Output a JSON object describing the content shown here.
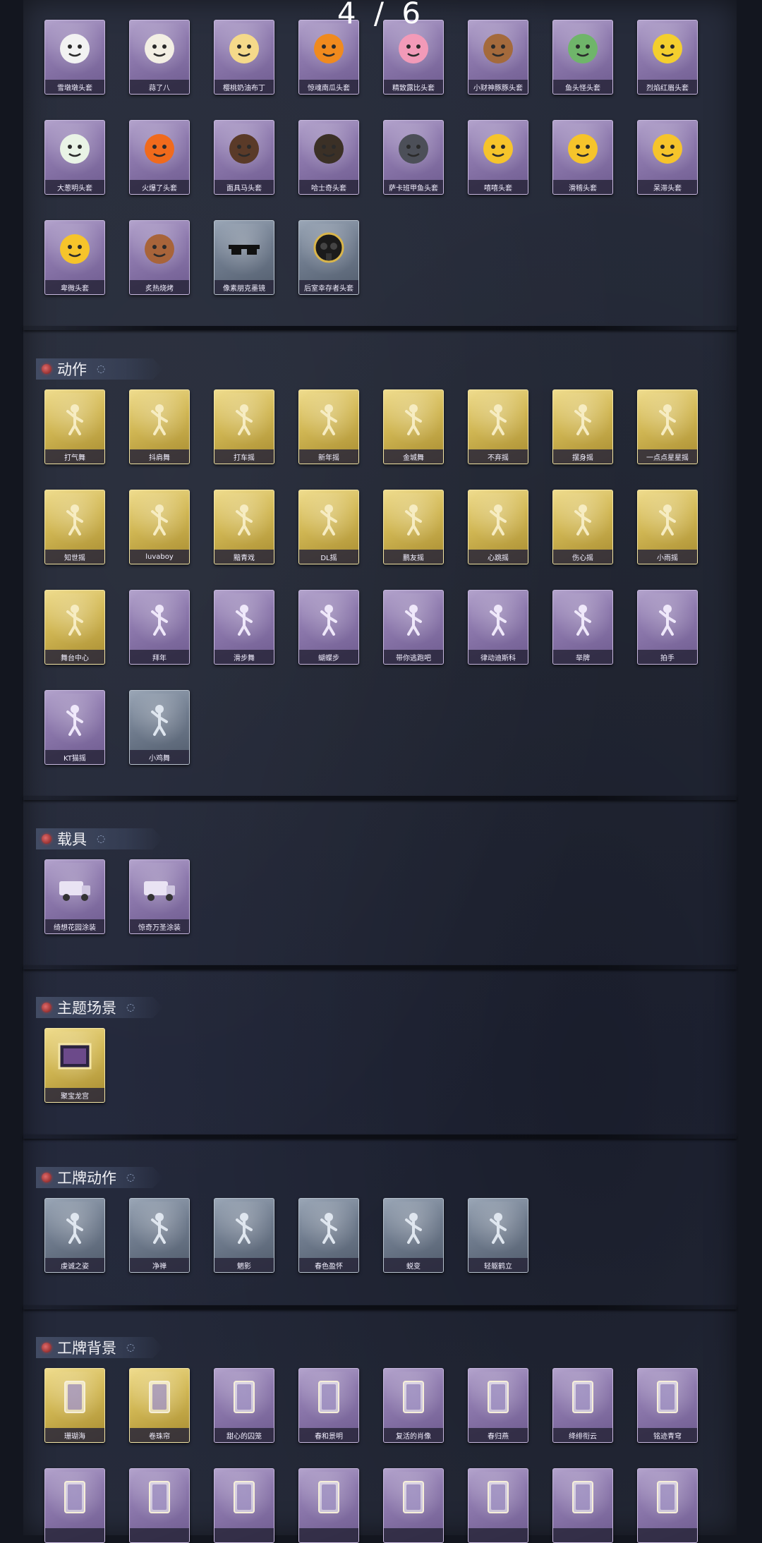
{
  "page_indicator": "4 / 6",
  "colors": {
    "purple": "#8d79ad",
    "gold": "#d0b653",
    "gray": "#6f7b8d"
  },
  "sections": [
    {
      "id": "masks",
      "title": "",
      "items": [
        {
          "label": "雪墩墩头套",
          "tier": "purple",
          "icon": "snowman-mask-icon"
        },
        {
          "label": "蒜了八",
          "tier": "purple",
          "icon": "garlic-icon"
        },
        {
          "label": "樱桃奶油布丁",
          "tier": "purple",
          "icon": "pudding-icon"
        },
        {
          "label": "惊魂南瓜头套",
          "tier": "purple",
          "icon": "pumpkin-icon"
        },
        {
          "label": "精致露比头套",
          "tier": "purple",
          "icon": "pink-creature-icon"
        },
        {
          "label": "小财神豚豚头套",
          "tier": "purple",
          "icon": "pig-icon"
        },
        {
          "label": "鱼头怪头套",
          "tier": "purple",
          "icon": "fish-head-icon"
        },
        {
          "label": "烈焰红眉头套",
          "tier": "purple",
          "icon": "yellow-mouse-icon"
        },
        {
          "label": "大葱明头套",
          "tier": "purple",
          "icon": "leek-icon"
        },
        {
          "label": "火爆了头套",
          "tier": "purple",
          "icon": "flame-face-icon"
        },
        {
          "label": "面具马头套",
          "tier": "purple",
          "icon": "horse-head-icon"
        },
        {
          "label": "哈士奇头套",
          "tier": "purple",
          "icon": "husky-icon"
        },
        {
          "label": "萨卡班甲鱼头套",
          "tier": "purple",
          "icon": "fish-icon"
        },
        {
          "label": "嘻嘻头套",
          "tier": "purple",
          "icon": "grin-emoji-icon"
        },
        {
          "label": "滑稽头套",
          "tier": "purple",
          "icon": "smirk-emoji-icon"
        },
        {
          "label": "呆滞头套",
          "tier": "purple",
          "icon": "dazed-emoji-icon"
        },
        {
          "label": "卑微头套",
          "tier": "purple",
          "icon": "humble-emoji-icon"
        },
        {
          "label": "炙热烧烤",
          "tier": "purple",
          "icon": "bbq-icon"
        },
        {
          "label": "像素朋克墨镜",
          "tier": "gray",
          "icon": "pixel-sunglasses-icon"
        },
        {
          "label": "后室幸存者头套",
          "tier": "gray",
          "icon": "gas-mask-icon"
        }
      ]
    },
    {
      "id": "actions",
      "title": "动作",
      "items": [
        {
          "label": "打气舞",
          "tier": "gold",
          "icon": "dance-pose-icon"
        },
        {
          "label": "抖肩舞",
          "tier": "gold",
          "icon": "dance-pose-icon"
        },
        {
          "label": "打车摇",
          "tier": "gold",
          "icon": "dance-pose-icon"
        },
        {
          "label": "新年摇",
          "tier": "gold",
          "icon": "dance-pose-icon"
        },
        {
          "label": "金城舞",
          "tier": "gold",
          "icon": "dance-pose-icon"
        },
        {
          "label": "不弃摇",
          "tier": "gold",
          "icon": "dance-pose-icon"
        },
        {
          "label": "摆身摇",
          "tier": "gold",
          "icon": "dance-pose-icon"
        },
        {
          "label": "一点点星星摇",
          "tier": "gold",
          "icon": "dance-pose-icon"
        },
        {
          "label": "知世摇",
          "tier": "gold",
          "icon": "dance-pose-icon"
        },
        {
          "label": "luvaboy",
          "tier": "gold",
          "icon": "dance-pose-icon"
        },
        {
          "label": "黯青戏",
          "tier": "gold",
          "icon": "dance-pose-icon"
        },
        {
          "label": "DL摇",
          "tier": "gold",
          "icon": "dance-pose-icon"
        },
        {
          "label": "鹏友摇",
          "tier": "gold",
          "icon": "dance-pose-icon"
        },
        {
          "label": "心跳摇",
          "tier": "gold",
          "icon": "dance-pose-icon"
        },
        {
          "label": "伤心摇",
          "tier": "gold",
          "icon": "dance-pose-icon"
        },
        {
          "label": "小雨摇",
          "tier": "gold",
          "icon": "dance-pose-icon"
        },
        {
          "label": "舞台中心",
          "tier": "gold",
          "icon": "dance-pose-icon"
        },
        {
          "label": "拜年",
          "tier": "purple",
          "icon": "dance-pose-icon"
        },
        {
          "label": "滑步舞",
          "tier": "purple",
          "icon": "dance-pose-icon"
        },
        {
          "label": "蝴蝶步",
          "tier": "purple",
          "icon": "dance-pose-icon"
        },
        {
          "label": "带你逃跑吧",
          "tier": "purple",
          "icon": "dance-pose-icon"
        },
        {
          "label": "律动迪斯科",
          "tier": "purple",
          "icon": "dance-pose-icon"
        },
        {
          "label": "举牌",
          "tier": "purple",
          "icon": "dance-pose-icon"
        },
        {
          "label": "拍手",
          "tier": "purple",
          "icon": "dance-pose-icon"
        },
        {
          "label": "KT猫摇",
          "tier": "purple",
          "icon": "dance-pose-icon"
        },
        {
          "label": "小鸡舞",
          "tier": "gray",
          "icon": "dance-pose-icon"
        }
      ]
    },
    {
      "id": "vehicles",
      "title": "载具",
      "items": [
        {
          "label": "绮想花园涂装",
          "tier": "purple",
          "icon": "ice-cream-truck-icon"
        },
        {
          "label": "惊奇万圣涂装",
          "tier": "purple",
          "icon": "halloween-truck-icon"
        }
      ]
    },
    {
      "id": "scenes",
      "title": "主题场景",
      "items": [
        {
          "label": "聚宝龙宫",
          "tier": "gold",
          "icon": "scene-frame-icon"
        }
      ]
    },
    {
      "id": "badge_actions",
      "title": "工牌动作",
      "items": [
        {
          "label": "虔诚之姿",
          "tier": "gray",
          "icon": "badge-pose-icon"
        },
        {
          "label": "净禅",
          "tier": "gray",
          "icon": "badge-pose-icon"
        },
        {
          "label": "魍影",
          "tier": "gray",
          "icon": "badge-pose-icon"
        },
        {
          "label": "春色盈怀",
          "tier": "gray",
          "icon": "badge-pose-icon"
        },
        {
          "label": "蜕变",
          "tier": "gray",
          "icon": "badge-pose-icon"
        },
        {
          "label": "轻躯鹤立",
          "tier": "gray",
          "icon": "badge-pose-icon"
        }
      ]
    },
    {
      "id": "badge_backgrounds",
      "title": "工牌背景",
      "items": [
        {
          "label": "珊瑚海",
          "tier": "gold",
          "icon": "card-coral-icon"
        },
        {
          "label": "卷珠帘",
          "tier": "gold",
          "icon": "card-curtain-icon"
        },
        {
          "label": "甜心的囚笼",
          "tier": "purple",
          "icon": "card-pink-icon"
        },
        {
          "label": "春和景明",
          "tier": "purple",
          "icon": "card-spring-icon"
        },
        {
          "label": "复活的肖像",
          "tier": "purple",
          "icon": "card-portrait-icon"
        },
        {
          "label": "春归燕",
          "tier": "purple",
          "icon": "card-swallow-icon"
        },
        {
          "label": "绛绯衔云",
          "tier": "purple",
          "icon": "card-red-icon"
        },
        {
          "label": "铭迹青穹",
          "tier": "purple",
          "icon": "card-teal-icon"
        },
        {
          "label": "",
          "tier": "purple",
          "icon": "card-violet-icon"
        },
        {
          "label": "",
          "tier": "purple",
          "icon": "card-sky-icon"
        },
        {
          "label": "",
          "tier": "purple",
          "icon": "card-lace-icon"
        },
        {
          "label": "",
          "tier": "purple",
          "icon": "card-night-icon"
        },
        {
          "label": "",
          "tier": "purple",
          "icon": "card-pastel-icon"
        },
        {
          "label": "",
          "tier": "purple",
          "icon": "card-gold-icon"
        },
        {
          "label": "",
          "tier": "purple",
          "icon": "card-dark-icon"
        },
        {
          "label": "",
          "tier": "purple",
          "icon": "card-glow-icon"
        }
      ]
    }
  ]
}
